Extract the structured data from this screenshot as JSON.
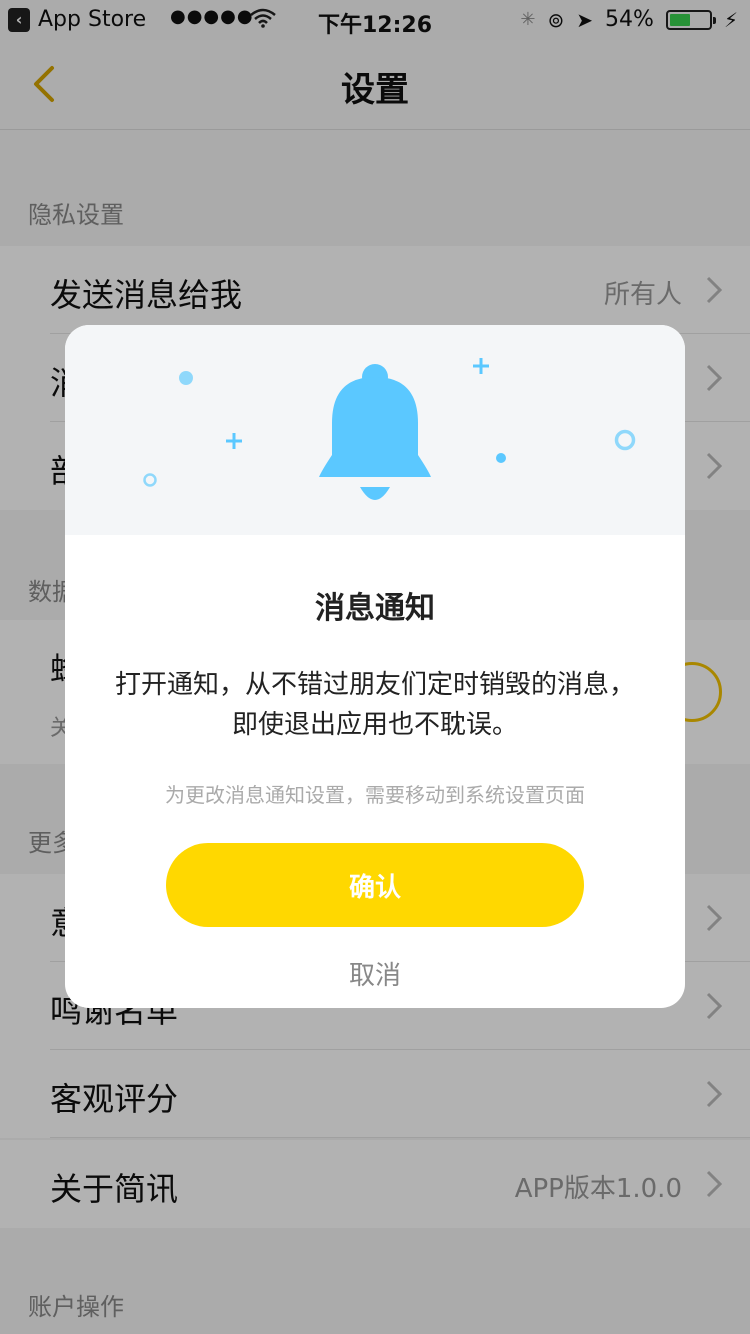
{
  "status_bar": {
    "back_app": "App Store",
    "signal": "●●●●●",
    "time": "下午12:26",
    "battery": "54%",
    "battery_level": 0.54
  },
  "nav": {
    "title": "设置"
  },
  "sections": {
    "privacy": "隐私设置",
    "data": "数据",
    "more": "更多",
    "account": "账户操作"
  },
  "rows": {
    "send_message": {
      "label": "发送消息给我",
      "value": "所有人"
    },
    "row2_label": "消",
    "row3_label": "部",
    "data_row_label": "蜂",
    "data_row_sub": "关",
    "more_row1_label": "意",
    "thanks": {
      "label": "鸣谢名单"
    },
    "rating": {
      "label": "客观评分"
    },
    "about": {
      "label": "关于简讯",
      "value": "APP版本1.0.0"
    }
  },
  "dialog": {
    "title": "消息通知",
    "body": "打开通知，从不错过朋友们定时销毁的消息，即使退出应用也不耽误。",
    "hint": "为更改消息通知设置，需要移动到系统设置页面",
    "confirm": "确认",
    "cancel": "取消",
    "icon": "bell-icon",
    "accent": "#ffd800",
    "bell_color": "#5bc8ff"
  }
}
